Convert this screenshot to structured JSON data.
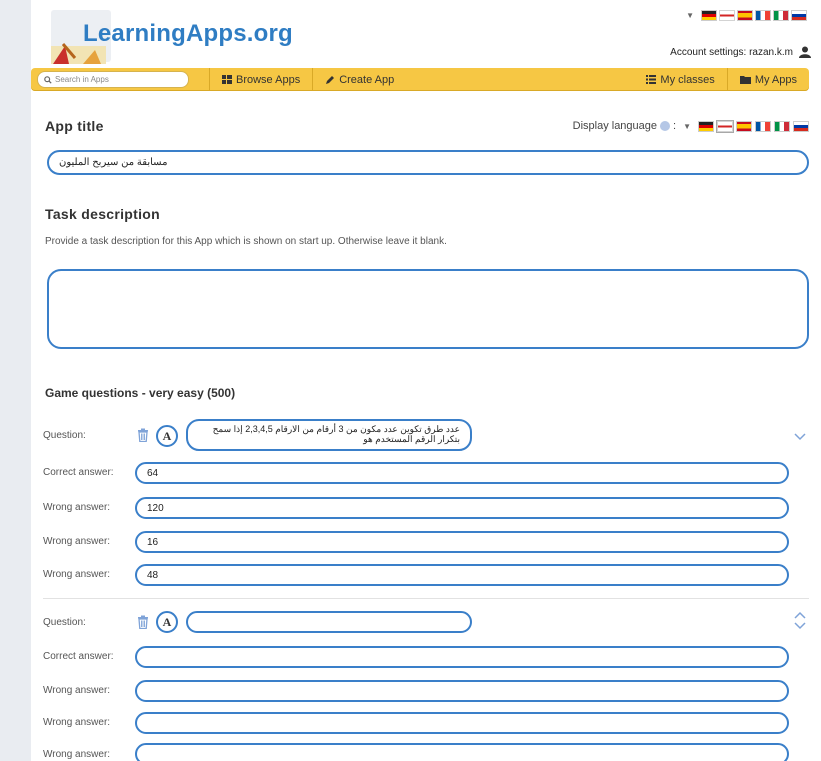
{
  "header": {
    "logo_text": "LearningApps.org",
    "account_label": "Account settings: razan.k.m"
  },
  "toolbar": {
    "search_placeholder": "Search in Apps",
    "browse_label": "Browse Apps",
    "create_label": "Create App",
    "classes_label": "My classes",
    "apps_label": "My Apps"
  },
  "app_title": {
    "heading": "App title",
    "display_language_label": "Display language",
    "display_language_sep": ":",
    "value": "مسابقة من سيربح المليون"
  },
  "task": {
    "heading": "Task description",
    "hint": "Provide a task description for this App which is shown on start up. Otherwise leave it blank.",
    "value": ""
  },
  "questions_section": {
    "heading": "Game questions - very easy (500)",
    "labels": {
      "question": "Question:",
      "correct": "Correct answer:",
      "wrong": "Wrong answer:"
    },
    "a_button": "A",
    "questions": [
      {
        "question": "عدد طرق تكوين عدد مكون من 3 أرقام من الارقام 2,3,4,5 إذا سمح بتكرار الرقم المستخدم هو",
        "correct": "64",
        "wrong": [
          "120",
          "16",
          "48"
        ]
      },
      {
        "question": "",
        "correct": "",
        "wrong": [
          "",
          "",
          ""
        ]
      }
    ]
  },
  "colors": {
    "accent_blue": "#3a7fc9",
    "toolbar_yellow": "#f6c744",
    "logo_blue": "#2f7dc3"
  }
}
